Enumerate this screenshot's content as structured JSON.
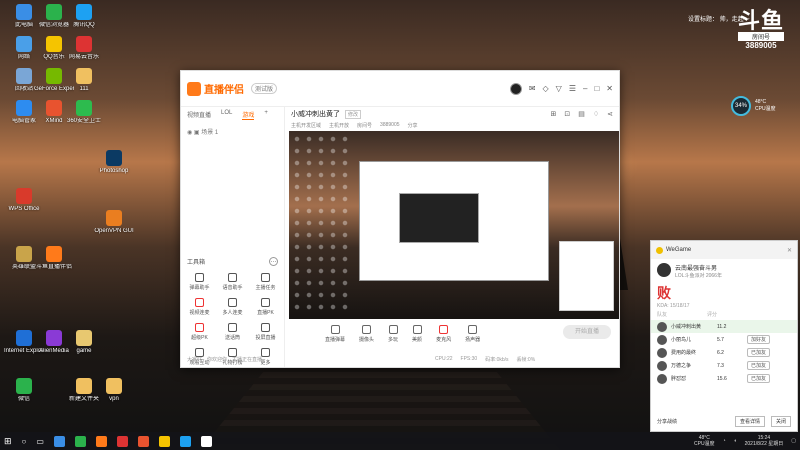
{
  "desktop_icons": [
    {
      "label": "此电脑",
      "color": "#3a8ee6"
    },
    {
      "label": "微信浏览器",
      "color": "#2bb24c"
    },
    {
      "label": "腾讯QQ",
      "color": "#1da1f2"
    },
    {
      "label": "网络",
      "color": "#4a9fe8"
    },
    {
      "label": "QQ音乐",
      "color": "#f5c400"
    },
    {
      "label": "网易云音乐",
      "color": "#d33"
    },
    {
      "label": "回收站",
      "color": "#7aa6d6"
    },
    {
      "label": "GeForce Experience",
      "color": "#76b900"
    },
    {
      "label": "111",
      "color": "#f0c060"
    },
    {
      "label": "电脑管家",
      "color": "#2d8cf0"
    },
    {
      "label": "XMind",
      "color": "#e8532f"
    },
    {
      "label": "360安全卫士",
      "color": "#2dbb4e"
    },
    {
      "label": "Photoshop",
      "color": "#0b3a63"
    },
    {
      "label": "WPS Office",
      "color": "#d93a2b"
    },
    {
      "label": "OpenVPN GUI",
      "color": "#ea7e20"
    },
    {
      "label": "英雄联盟",
      "color": "#c9a44a"
    },
    {
      "label": "斗鱼直播伴侣",
      "color": "#ff7a1a"
    },
    {
      "label": "Internet Explorer",
      "color": "#1f6fd6"
    },
    {
      "label": "AlienMedia",
      "color": "#8a3ad6"
    },
    {
      "label": "game",
      "color": "#e8c870"
    },
    {
      "label": "微信",
      "color": "#2bb24c"
    },
    {
      "label": "新建文件夹",
      "color": "#f0c060"
    },
    {
      "label": "vpn",
      "color": "#f0c060"
    }
  ],
  "main_window": {
    "app_name": "直播伴侣",
    "version_badge": "测试版",
    "tabs": [
      "视频直播",
      "LOL",
      "游戏"
    ],
    "scene_label": "场景 1",
    "room_title": "小威冲刺出黄了",
    "edit_label": "修改",
    "room_meta": [
      "主机开发区域",
      "主机开放",
      "房间号",
      "3889005",
      "分享"
    ],
    "tools_title": "工具箱",
    "tools": [
      {
        "label": "弹幕助手",
        "red": false
      },
      {
        "label": "语音助手",
        "red": false
      },
      {
        "label": "主播任务",
        "red": false
      },
      {
        "label": "视频连麦",
        "red": true
      },
      {
        "label": "多人连麦",
        "red": false
      },
      {
        "label": "直播PK",
        "red": false
      },
      {
        "label": "超级PK",
        "red": true
      },
      {
        "label": "送话筒",
        "red": false
      },
      {
        "label": "投屏直播",
        "red": false
      },
      {
        "label": "观看互动",
        "red": false
      },
      {
        "label": "礼物打榜",
        "red": false
      },
      {
        "label": "更多",
        "red": false
      }
    ],
    "bottom_note": "大家好，你欢迎你，主播正在直播",
    "controls": [
      {
        "label": "直播弹幕",
        "red": false
      },
      {
        "label": "摄像头",
        "red": false
      },
      {
        "label": "多玩",
        "red": false
      },
      {
        "label": "美颜",
        "red": false
      },
      {
        "label": "麦克风",
        "red": true
      },
      {
        "label": "扬声器",
        "red": false
      }
    ],
    "go_live_label": "开始直播",
    "status": [
      "CPU:22",
      "FPS:30",
      "码率:0kb/s",
      "丢帧:0%"
    ]
  },
  "wegame": {
    "title": "WeGame",
    "player_name": "云南最强奋斗男",
    "player_sub": "LOL斗鱼派对 2066年",
    "result": "败",
    "kda": "KDA: 15/18/17",
    "columns": [
      "队友",
      "评分"
    ],
    "rows": [
      {
        "name": "小威冲刺出黄",
        "score": "11.2",
        "button": ""
      },
      {
        "name": "小丽鸟儿",
        "score": "5.7",
        "button": "加好友"
      },
      {
        "name": "费用的最终",
        "score": "6.2",
        "button": "已加友"
      },
      {
        "name": "万德之争",
        "score": "7.3",
        "button": "已加友"
      },
      {
        "name": "胖怼怼",
        "score": "15.6",
        "button": "已加友"
      }
    ],
    "footer_left": "分享战绩",
    "footer_btn1": "查看详情",
    "footer_btn2": "关闭"
  },
  "overlay": {
    "douyu_logo": "斗鱼",
    "douyu_sub": "房间号",
    "room_id": "3889005",
    "room_settings": "设置标题： 帅，走起～"
  },
  "cpu_widget": {
    "percent": "34%",
    "temp": "48°C",
    "label": "CPU温度"
  },
  "taskbar": {
    "icons": [
      "#3a8ee6",
      "#2bb24c",
      "#ff7a1a",
      "#d33",
      "#e8532f",
      "#f5c400",
      "#1da1f2",
      "#fff"
    ],
    "cpu_temp": "48°C",
    "cpu_label": "CPU温度",
    "time": "15:24",
    "date": "2021/8/22 星期日"
  }
}
